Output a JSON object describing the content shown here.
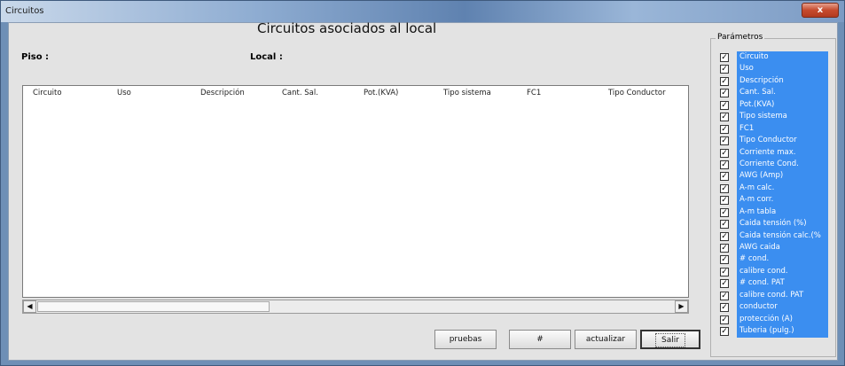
{
  "window": {
    "title": "Circuitos",
    "close_label": "x"
  },
  "header": {
    "title": "Circuitos asociados al local",
    "piso_label": "Piso :",
    "local_label": "Local :"
  },
  "grid": {
    "columns": [
      "Circuito",
      "Uso",
      "Descripción",
      "Cant. Sal.",
      "Pot.(KVA)",
      "Tipo sistema",
      "FC1",
      "Tipo Conductor"
    ],
    "rows": []
  },
  "scrollbar": {
    "left_arrow": "◀",
    "right_arrow": "▶"
  },
  "buttons": {
    "pruebas": "pruebas",
    "hash": "#",
    "actualizar": "actualizar",
    "salir": "Salir"
  },
  "parametros": {
    "legend": "Parámetros",
    "check_glyph": "✓",
    "items": [
      "Circuito",
      "Uso",
      "Descripción",
      "Cant. Sal.",
      "Pot.(KVA)",
      "Tipo sistema",
      "FC1",
      "Tipo Conductor",
      "Corriente max.",
      "Corriente Cond.",
      "AWG (Amp)",
      "A-m calc.",
      "A-m corr.",
      "A-m tabla",
      "Caida tensión (%)",
      "Caida tensión calc.(%",
      "AWG caida",
      "# cond.",
      "calibre cond.",
      "# cond. PAT",
      "calibre cond. PAT",
      "conductor",
      "protección (A)",
      "Tuberia (pulg.)"
    ]
  }
}
